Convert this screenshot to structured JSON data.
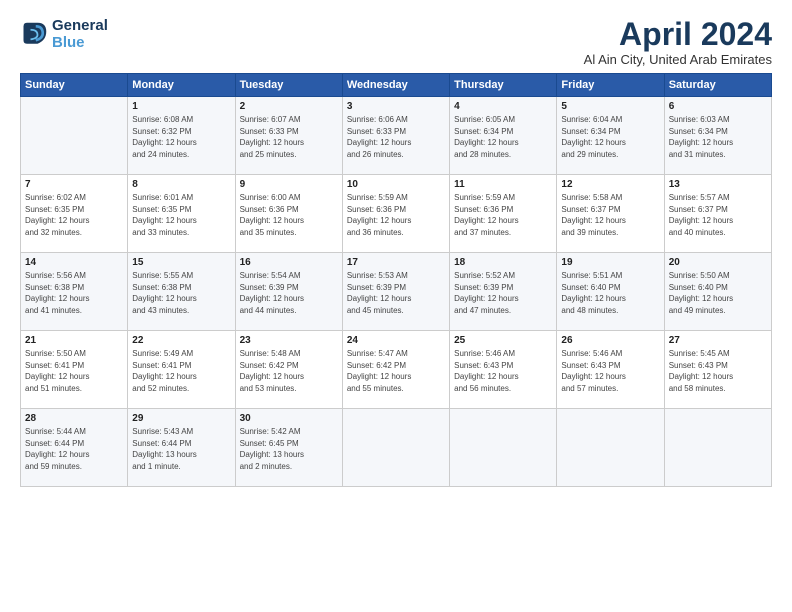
{
  "logo": {
    "text_line1": "General",
    "text_line2": "Blue"
  },
  "title": "April 2024",
  "subtitle": "Al Ain City, United Arab Emirates",
  "days_of_week": [
    "Sunday",
    "Monday",
    "Tuesday",
    "Wednesday",
    "Thursday",
    "Friday",
    "Saturday"
  ],
  "weeks": [
    [
      {
        "day": "",
        "info": ""
      },
      {
        "day": "1",
        "info": "Sunrise: 6:08 AM\nSunset: 6:32 PM\nDaylight: 12 hours\nand 24 minutes."
      },
      {
        "day": "2",
        "info": "Sunrise: 6:07 AM\nSunset: 6:33 PM\nDaylight: 12 hours\nand 25 minutes."
      },
      {
        "day": "3",
        "info": "Sunrise: 6:06 AM\nSunset: 6:33 PM\nDaylight: 12 hours\nand 26 minutes."
      },
      {
        "day": "4",
        "info": "Sunrise: 6:05 AM\nSunset: 6:34 PM\nDaylight: 12 hours\nand 28 minutes."
      },
      {
        "day": "5",
        "info": "Sunrise: 6:04 AM\nSunset: 6:34 PM\nDaylight: 12 hours\nand 29 minutes."
      },
      {
        "day": "6",
        "info": "Sunrise: 6:03 AM\nSunset: 6:34 PM\nDaylight: 12 hours\nand 31 minutes."
      }
    ],
    [
      {
        "day": "7",
        "info": "Sunrise: 6:02 AM\nSunset: 6:35 PM\nDaylight: 12 hours\nand 32 minutes."
      },
      {
        "day": "8",
        "info": "Sunrise: 6:01 AM\nSunset: 6:35 PM\nDaylight: 12 hours\nand 33 minutes."
      },
      {
        "day": "9",
        "info": "Sunrise: 6:00 AM\nSunset: 6:36 PM\nDaylight: 12 hours\nand 35 minutes."
      },
      {
        "day": "10",
        "info": "Sunrise: 5:59 AM\nSunset: 6:36 PM\nDaylight: 12 hours\nand 36 minutes."
      },
      {
        "day": "11",
        "info": "Sunrise: 5:59 AM\nSunset: 6:36 PM\nDaylight: 12 hours\nand 37 minutes."
      },
      {
        "day": "12",
        "info": "Sunrise: 5:58 AM\nSunset: 6:37 PM\nDaylight: 12 hours\nand 39 minutes."
      },
      {
        "day": "13",
        "info": "Sunrise: 5:57 AM\nSunset: 6:37 PM\nDaylight: 12 hours\nand 40 minutes."
      }
    ],
    [
      {
        "day": "14",
        "info": "Sunrise: 5:56 AM\nSunset: 6:38 PM\nDaylight: 12 hours\nand 41 minutes."
      },
      {
        "day": "15",
        "info": "Sunrise: 5:55 AM\nSunset: 6:38 PM\nDaylight: 12 hours\nand 43 minutes."
      },
      {
        "day": "16",
        "info": "Sunrise: 5:54 AM\nSunset: 6:39 PM\nDaylight: 12 hours\nand 44 minutes."
      },
      {
        "day": "17",
        "info": "Sunrise: 5:53 AM\nSunset: 6:39 PM\nDaylight: 12 hours\nand 45 minutes."
      },
      {
        "day": "18",
        "info": "Sunrise: 5:52 AM\nSunset: 6:39 PM\nDaylight: 12 hours\nand 47 minutes."
      },
      {
        "day": "19",
        "info": "Sunrise: 5:51 AM\nSunset: 6:40 PM\nDaylight: 12 hours\nand 48 minutes."
      },
      {
        "day": "20",
        "info": "Sunrise: 5:50 AM\nSunset: 6:40 PM\nDaylight: 12 hours\nand 49 minutes."
      }
    ],
    [
      {
        "day": "21",
        "info": "Sunrise: 5:50 AM\nSunset: 6:41 PM\nDaylight: 12 hours\nand 51 minutes."
      },
      {
        "day": "22",
        "info": "Sunrise: 5:49 AM\nSunset: 6:41 PM\nDaylight: 12 hours\nand 52 minutes."
      },
      {
        "day": "23",
        "info": "Sunrise: 5:48 AM\nSunset: 6:42 PM\nDaylight: 12 hours\nand 53 minutes."
      },
      {
        "day": "24",
        "info": "Sunrise: 5:47 AM\nSunset: 6:42 PM\nDaylight: 12 hours\nand 55 minutes."
      },
      {
        "day": "25",
        "info": "Sunrise: 5:46 AM\nSunset: 6:43 PM\nDaylight: 12 hours\nand 56 minutes."
      },
      {
        "day": "26",
        "info": "Sunrise: 5:46 AM\nSunset: 6:43 PM\nDaylight: 12 hours\nand 57 minutes."
      },
      {
        "day": "27",
        "info": "Sunrise: 5:45 AM\nSunset: 6:43 PM\nDaylight: 12 hours\nand 58 minutes."
      }
    ],
    [
      {
        "day": "28",
        "info": "Sunrise: 5:44 AM\nSunset: 6:44 PM\nDaylight: 12 hours\nand 59 minutes."
      },
      {
        "day": "29",
        "info": "Sunrise: 5:43 AM\nSunset: 6:44 PM\nDaylight: 13 hours\nand 1 minute."
      },
      {
        "day": "30",
        "info": "Sunrise: 5:42 AM\nSunset: 6:45 PM\nDaylight: 13 hours\nand 2 minutes."
      },
      {
        "day": "",
        "info": ""
      },
      {
        "day": "",
        "info": ""
      },
      {
        "day": "",
        "info": ""
      },
      {
        "day": "",
        "info": ""
      }
    ]
  ]
}
